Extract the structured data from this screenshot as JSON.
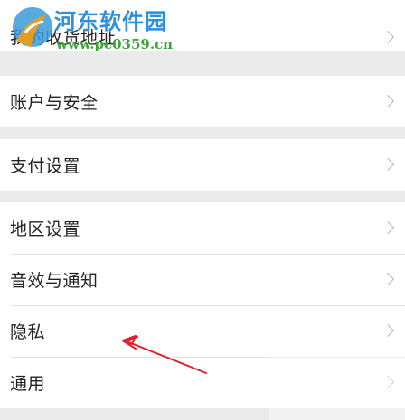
{
  "settings": {
    "groups": [
      {
        "items": [
          {
            "label": "我的收货地址"
          }
        ]
      },
      {
        "items": [
          {
            "label": "账户与安全"
          }
        ]
      },
      {
        "items": [
          {
            "label": "支付设置"
          }
        ]
      },
      {
        "items": [
          {
            "label": "地区设置"
          },
          {
            "label": "音效与通知"
          },
          {
            "label": "隐私"
          },
          {
            "label": "通用"
          }
        ]
      }
    ]
  },
  "watermark": {
    "site_name": "河东软件园",
    "url": "www.pc0359.cn"
  },
  "annotation": {
    "arrow_color": "#e0202a",
    "points_to": "隐私"
  }
}
